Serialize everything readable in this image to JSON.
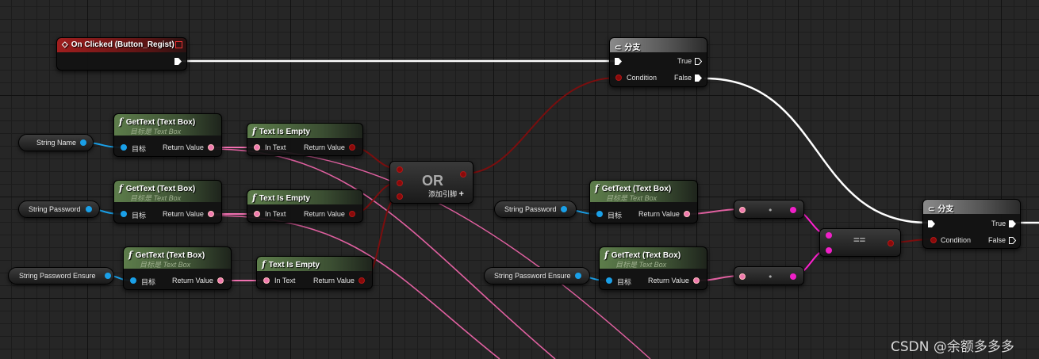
{
  "event_node": {
    "title": "On Clicked (Button_Regist)"
  },
  "branch_top": {
    "title": "分支",
    "true_label": "True",
    "false_label": "False",
    "condition_label": "Condition"
  },
  "branch_bottom": {
    "title": "分支",
    "true_label": "True",
    "false_label": "False",
    "condition_label": "Condition"
  },
  "gettext": {
    "title": "GetText (Text Box)",
    "subtitle": "目标是 Text Box",
    "target_label": "目标",
    "return_label": "Return Value"
  },
  "textisempty": {
    "title": "Text Is Empty",
    "in_label": "In Text",
    "return_label": "Return Value"
  },
  "or_node": {
    "title": "OR",
    "add_pin_label": "添加引脚",
    "add_pin_symbol": "+"
  },
  "equal_node": {
    "title": "=="
  },
  "variables": {
    "string_name": "String Name",
    "string_password": "String Password",
    "string_password_ensure": "String Password Ensure",
    "string_password_right": "String Password",
    "string_password_ensure_right": "String Password Ensure"
  },
  "watermark": "CSDN @余额多多多",
  "colors": {
    "exec_wire": "#ffffff",
    "bool_wire": "#7a0e0e",
    "string_wire": "#f070b0",
    "text_wire": "#e060a0",
    "object_wire": "#1aa0e8",
    "magenta_wire": "#ff20d0"
  }
}
